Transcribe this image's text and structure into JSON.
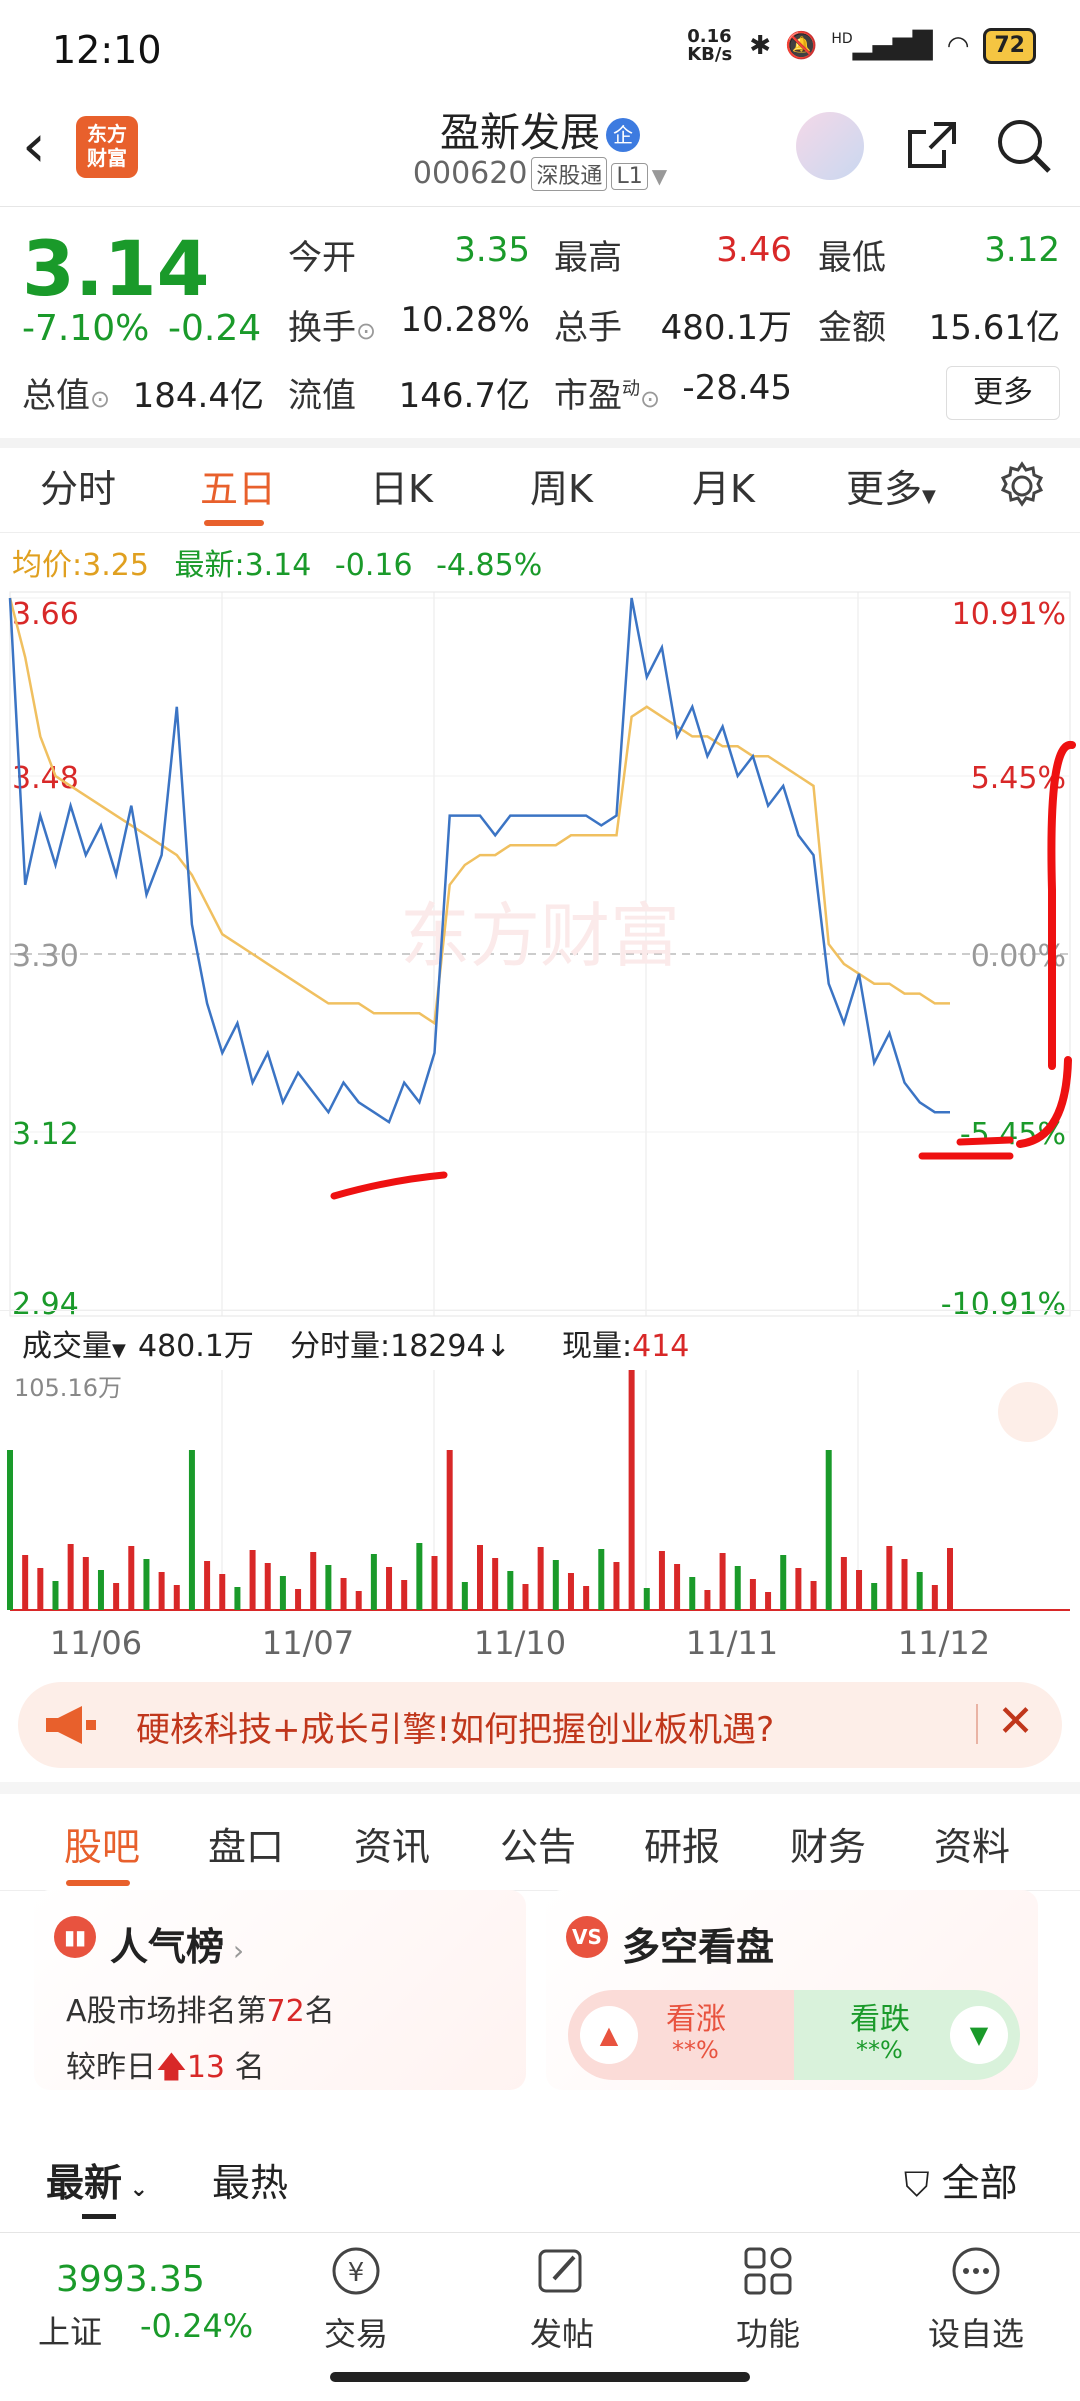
{
  "status": {
    "time": "12:10",
    "net_speed": "0.16\nKB/s",
    "signal": "HD",
    "battery": "72"
  },
  "header": {
    "logo_text": "东方\n财富",
    "name": "盈新发展",
    "badge": "企",
    "code": "000620",
    "tag1": "深股通",
    "tag2": "L1"
  },
  "quote": {
    "price": "3.14",
    "pct": "-7.10%",
    "change": "-0.24",
    "jinkai_label": "今开",
    "jinkai": "3.35",
    "zuigao_label": "最高",
    "zuigao": "3.46",
    "zuidi_label": "最低",
    "zuidi": "3.12",
    "huanshou_label": "换手",
    "huanshou": "10.28%",
    "zongshou_label": "总手",
    "zongshou": "480.1万",
    "jine_label": "金额",
    "jine": "15.61亿",
    "zongzhi_label": "总值",
    "zongzhi": "184.4亿",
    "liuzhi_label": "流值",
    "liuzhi": "146.7亿",
    "shiying_label": "市盈",
    "shiying_sup": "动",
    "shiying": "-28.45",
    "more": "更多"
  },
  "tabs": [
    "分时",
    "五日",
    "日K",
    "周K",
    "月K",
    "更多"
  ],
  "avg_bar": {
    "avg_label": "均价:",
    "avg": "3.25",
    "latest_label": "最新:",
    "latest": "3.14",
    "chg": "-0.16",
    "pct": "-4.85%"
  },
  "chart_data": {
    "type": "line",
    "title": "",
    "x_labels": [
      "11/06",
      "11/07",
      "11/10",
      "11/11",
      "11/12"
    ],
    "y_left_ticks": [
      "3.66",
      "3.48",
      "3.30",
      "3.12",
      "2.94"
    ],
    "y_right_ticks": [
      "10.91%",
      "5.45%",
      "0.00%",
      "-5.45%",
      "-10.91%"
    ],
    "ylim": [
      2.94,
      3.66
    ],
    "prev_close": 3.3,
    "series": [
      {
        "name": "价格",
        "values": [
          3.66,
          3.37,
          3.44,
          3.39,
          3.45,
          3.4,
          3.43,
          3.38,
          3.45,
          3.36,
          3.4,
          3.55,
          3.33,
          3.25,
          3.2,
          3.23,
          3.17,
          3.2,
          3.15,
          3.18,
          3.16,
          3.14,
          3.17,
          3.15,
          3.14,
          3.13,
          3.17,
          3.15,
          3.2,
          3.44,
          3.44,
          3.44,
          3.42,
          3.44,
          3.44,
          3.44,
          3.44,
          3.44,
          3.44,
          3.43,
          3.44,
          3.66,
          3.58,
          3.61,
          3.52,
          3.55,
          3.5,
          3.53,
          3.48,
          3.5,
          3.45,
          3.47,
          3.42,
          3.4,
          3.27,
          3.23,
          3.28,
          3.19,
          3.22,
          3.17,
          3.15,
          3.14,
          3.14
        ]
      },
      {
        "name": "均价",
        "values": [
          3.66,
          3.6,
          3.52,
          3.48,
          3.47,
          3.46,
          3.45,
          3.44,
          3.43,
          3.42,
          3.41,
          3.4,
          3.38,
          3.35,
          3.32,
          3.31,
          3.3,
          3.29,
          3.28,
          3.27,
          3.26,
          3.25,
          3.25,
          3.25,
          3.24,
          3.24,
          3.24,
          3.24,
          3.23,
          3.37,
          3.39,
          3.4,
          3.4,
          3.41,
          3.41,
          3.41,
          3.41,
          3.42,
          3.42,
          3.42,
          3.42,
          3.54,
          3.55,
          3.54,
          3.53,
          3.52,
          3.52,
          3.51,
          3.51,
          3.5,
          3.5,
          3.49,
          3.48,
          3.47,
          3.31,
          3.29,
          3.28,
          3.27,
          3.27,
          3.26,
          3.26,
          3.25,
          3.25
        ]
      }
    ],
    "annotations": [
      "red hand-drawn underline near 3.12 on 11/07",
      "red hand-drawn underline near 3.12 on 11/12",
      "red hand-drawn bracket on right edge"
    ],
    "colors": {
      "price": "#3b74c4",
      "avg": "#f0c060",
      "annot": "#ee1111"
    }
  },
  "volume": {
    "label": "成交量",
    "total": "480.1万",
    "fenshi_label": "分时量:",
    "fenshi": "18294",
    "xianliang_label": "现量:",
    "xianliang": "414",
    "max_label": "105.16万"
  },
  "banner": {
    "text": "硬核科技+成长引擎!如何把握创业板机遇?"
  },
  "section_tabs": [
    "股吧",
    "盘口",
    "资讯",
    "公告",
    "研报",
    "财务",
    "资料"
  ],
  "cards": {
    "popular": {
      "title": "人气榜",
      "line1_a": "A股市场排名第",
      "line1_num": "72",
      "line1_b": "名",
      "line2_a": "较昨日",
      "line2_num": "13",
      "line2_b": "名"
    },
    "vote": {
      "title": "多空看盘",
      "up": "看涨",
      "up_pct": "**%",
      "down": "看跌",
      "down_pct": "**%"
    }
  },
  "filter": {
    "latest": "最新",
    "hot": "最热",
    "all": "全部"
  },
  "bottom": {
    "index_value": "3993.35",
    "index_name": "上证",
    "index_change": "-0.24%",
    "items": [
      "交易",
      "发帖",
      "功能",
      "设自选"
    ]
  }
}
